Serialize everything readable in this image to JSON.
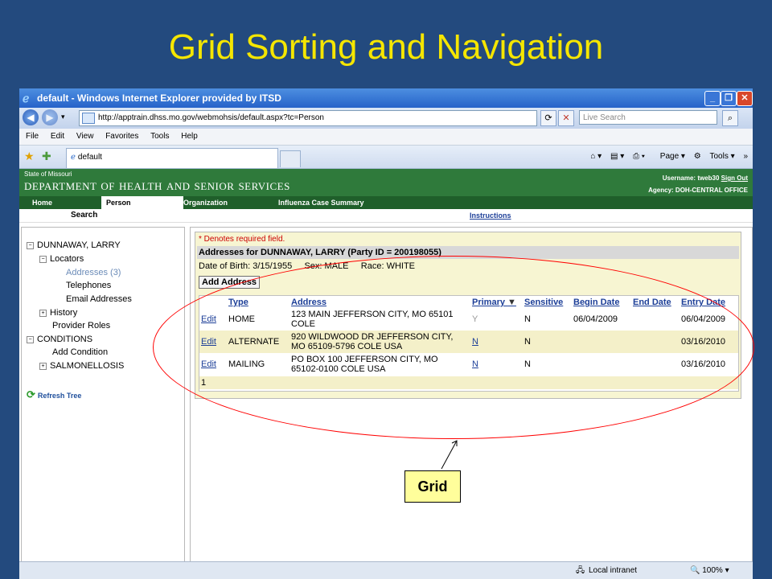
{
  "slide": {
    "title": "Grid Sorting and Navigation",
    "callout_label": "Grid"
  },
  "window": {
    "title": "default - Windows Internet Explorer provided by ITSD",
    "url": "http://apptrain.dhss.mo.gov/webmohsis/default.aspx?tc=Person",
    "search_placeholder": "Live Search",
    "menu": [
      "File",
      "Edit",
      "View",
      "Favorites",
      "Tools",
      "Help"
    ],
    "tab_label": "default",
    "tools": [
      "Page",
      "Tools"
    ],
    "status_zone": "Local intranet",
    "zoom": "100%"
  },
  "header": {
    "state": "State of Missouri",
    "dept": "Department of Health and Senior Services",
    "username_label": "Username:",
    "username": "tweb30",
    "sign_out": "Sign Out",
    "agency_label": "Agency:",
    "agency": "DOH-CENTRAL OFFICE",
    "nav": [
      "Home",
      "Person",
      "Organization",
      "Influenza Case Summary"
    ],
    "subnav_search": "Search",
    "instructions": "Instructions"
  },
  "tree": {
    "person": "DUNNAWAY, LARRY",
    "locators": "Locators",
    "addresses": "Addresses (3)",
    "telephones": "Telephones",
    "emails": "Email Addresses",
    "history": "History",
    "provider_roles": "Provider Roles",
    "conditions": "CONDITIONS",
    "add_condition": "Add Condition",
    "salmonellosis": "SALMONELLOSIS",
    "refresh": "Refresh Tree"
  },
  "panel": {
    "required_note": "* Denotes required field.",
    "heading": "Addresses for DUNNAWAY, LARRY (Party ID = 200198055)",
    "dob": "Date of Birth:  3/15/1955",
    "sex": "Sex:  MALE",
    "race": "Race:  WHITE",
    "add_button": "Add Address",
    "grid": {
      "headers": [
        "Type",
        "Address",
        "Primary",
        "Sensitive",
        "Begin Date",
        "End Date",
        "Entry Date"
      ],
      "sort_indicator": "▼",
      "rows": [
        {
          "edit": "Edit",
          "type": "HOME",
          "addr1": "123 MAIN JEFFERSON CITY, MO 65101",
          "addr2": "COLE",
          "primary": "Y",
          "sensitive": "N",
          "begin": "06/04/2009",
          "end": "",
          "entry": "06/04/2009"
        },
        {
          "edit": "Edit",
          "type": "ALTERNATE",
          "addr1": "920 WILDWOOD DR JEFFERSON CITY,",
          "addr2": "MO 65109-5796 COLE USA",
          "primary": "N",
          "sensitive": "N",
          "begin": "",
          "end": "",
          "entry": "03/16/2010"
        },
        {
          "edit": "Edit",
          "type": "MAILING",
          "addr1": "PO BOX 100 JEFFERSON CITY, MO",
          "addr2": "65102-0100 COLE USA",
          "primary": "N",
          "sensitive": "N",
          "begin": "",
          "end": "",
          "entry": "03/16/2010"
        }
      ],
      "page": "1"
    }
  }
}
